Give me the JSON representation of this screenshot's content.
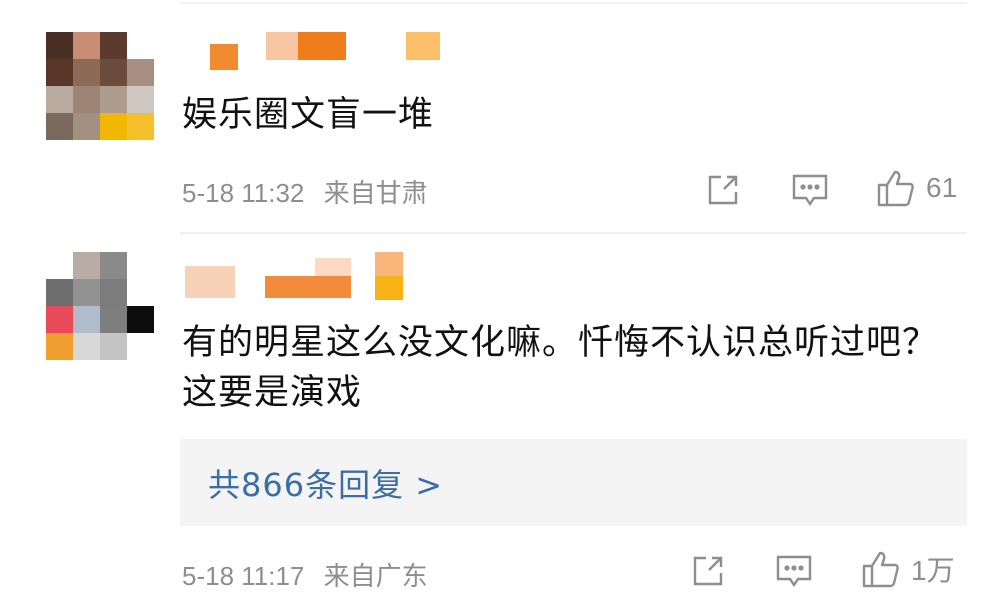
{
  "comments": [
    {
      "text": "娱乐圈文盲一堆",
      "time": "5-18 11:32",
      "location": "来自甘肃",
      "likes": "61",
      "share_icon": "share-icon",
      "comment_icon": "comment-icon",
      "like_icon": "thumbs-up-icon"
    },
    {
      "text": "有的明星这么没文化嘛。忏悔不认识总听过吧？这要是演戏",
      "time": "5-18 11:17",
      "location": "来自广东",
      "likes": "1万",
      "replies_label": "共866条回复 >",
      "share_icon": "share-icon",
      "comment_icon": "comment-icon",
      "like_icon": "thumbs-up-icon"
    }
  ],
  "colors": {
    "link": "#3b6ea5",
    "meta": "#8e8e8e",
    "reply_bg": "#f4f4f4"
  }
}
